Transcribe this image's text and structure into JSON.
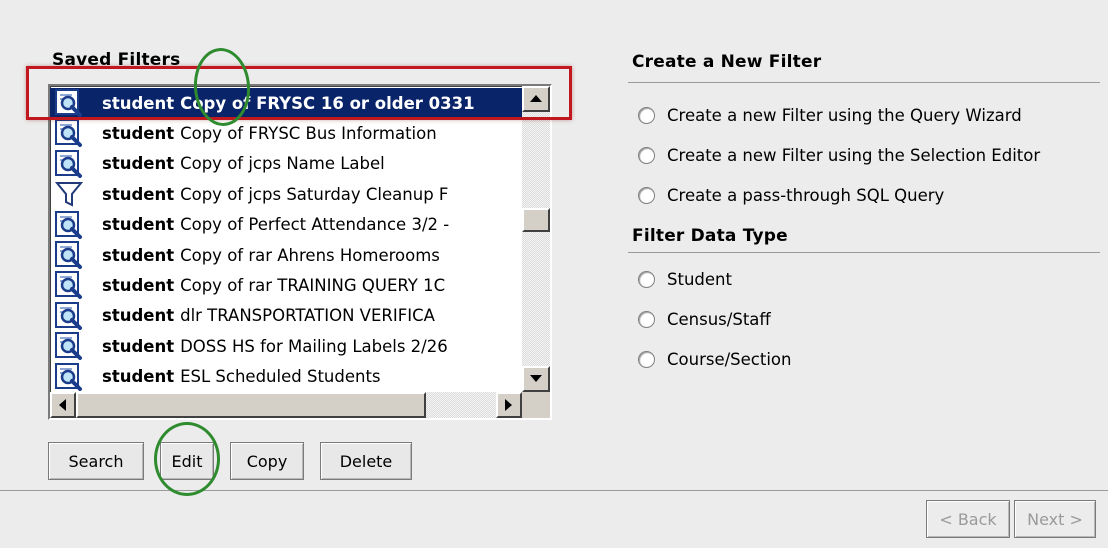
{
  "saved_filters": {
    "title": "Saved Filters",
    "items": [
      {
        "type": "student",
        "name": "Copy of FRYSC 16 or older 0331",
        "icon": "query-icon",
        "selected": true
      },
      {
        "type": "student",
        "name": "Copy of FRYSC Bus Information",
        "icon": "query-icon"
      },
      {
        "type": "student",
        "name": "Copy of jcps Name Label",
        "icon": "query-icon"
      },
      {
        "type": "student",
        "name": "Copy of jcps Saturday Cleanup F",
        "icon": "funnel-icon"
      },
      {
        "type": "student",
        "name": "Copy of Perfect Attendance 3/2 -",
        "icon": "query-icon"
      },
      {
        "type": "student",
        "name": "Copy of rar Ahrens Homerooms",
        "icon": "query-icon"
      },
      {
        "type": "student",
        "name": "Copy of rar TRAINING QUERY 1C",
        "icon": "query-icon"
      },
      {
        "type": "student",
        "name": "dlr TRANSPORTATION VERIFICA",
        "icon": "query-icon"
      },
      {
        "type": "student",
        "name": "DOSS HS for Mailing Labels 2/26",
        "icon": "query-icon"
      },
      {
        "type": "student",
        "name": "ESL Scheduled Students",
        "icon": "query-icon"
      }
    ]
  },
  "buttons": {
    "search": "Search",
    "edit": "Edit",
    "copy": "Copy",
    "delete": "Delete"
  },
  "create_filter": {
    "title": "Create a New Filter",
    "options": [
      "Create a new Filter using the Query Wizard",
      "Create a new Filter using the Selection Editor",
      "Create a pass-through SQL Query"
    ]
  },
  "data_type": {
    "title": "Filter Data Type",
    "options": [
      "Student",
      "Census/Staff",
      "Course/Section"
    ]
  },
  "nav": {
    "back": "< Back",
    "next": "Next >"
  },
  "colors": {
    "selection": "#0a246a",
    "annotation_red": "#c0181e",
    "annotation_green": "#2e8b2e"
  }
}
